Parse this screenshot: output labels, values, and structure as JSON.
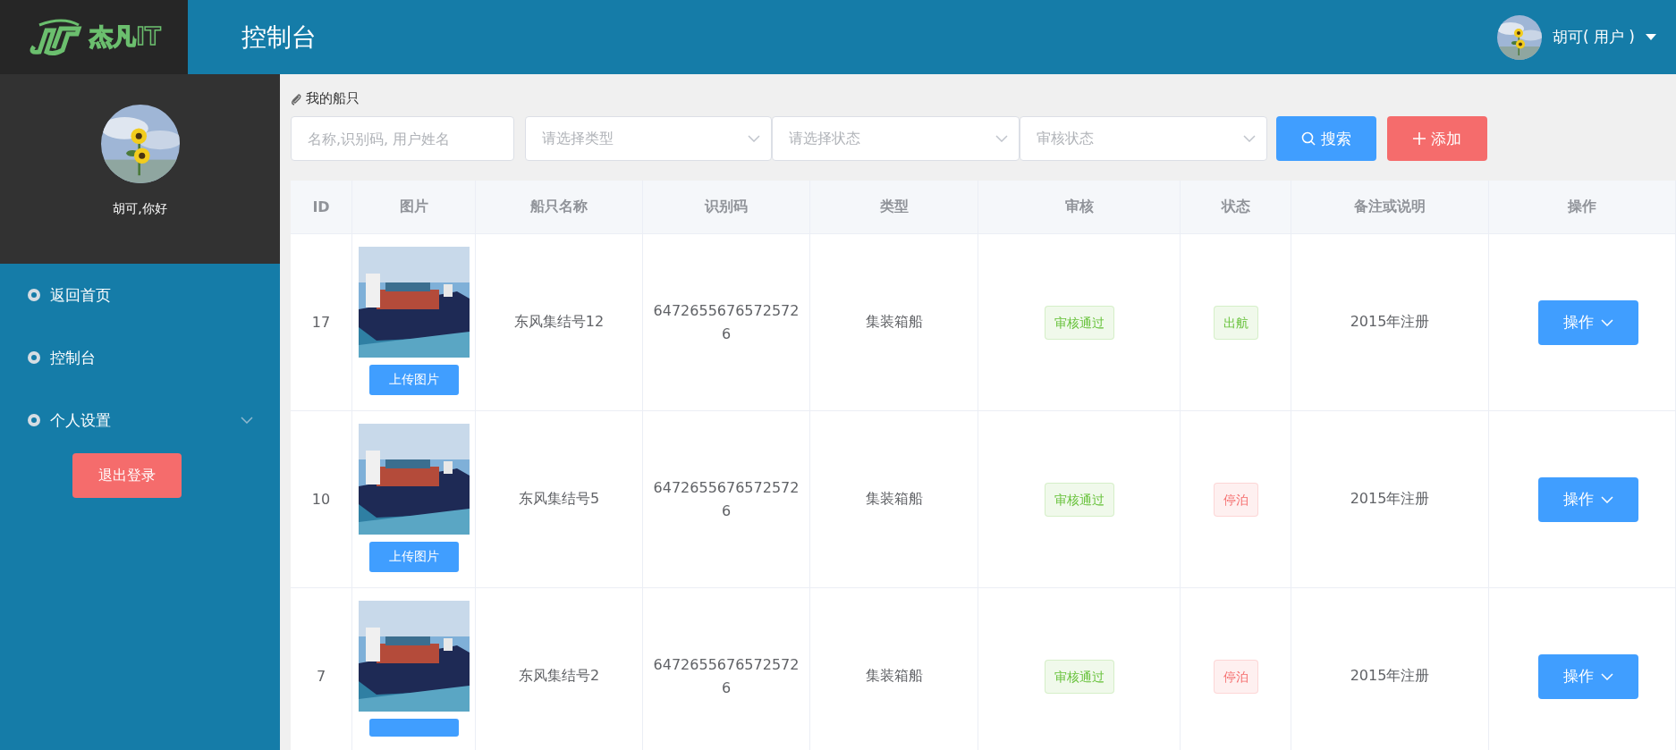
{
  "header": {
    "logo_text": "杰凡IT",
    "title": "控制台",
    "user": "胡可( 用户 )"
  },
  "sidebar": {
    "greeting": "胡可,你好",
    "items": [
      {
        "label": "返回首页",
        "has_submenu": false
      },
      {
        "label": "控制台",
        "has_submenu": false
      },
      {
        "label": "个人设置",
        "has_submenu": true
      }
    ],
    "logout": "退出登录"
  },
  "page": {
    "title": "我的船只"
  },
  "filters": {
    "search": {
      "placeholder": "名称,识别码, 用户姓名"
    },
    "selects": [
      {
        "placeholder": "请选择类型"
      },
      {
        "placeholder": "请选择状态"
      },
      {
        "placeholder": "审核状态"
      }
    ],
    "search_button": "搜索",
    "add_button": "添加"
  },
  "table": {
    "columns": [
      "ID",
      "图片",
      "船只名称",
      "识别码",
      "类型",
      "审核",
      "状态",
      "备注或说明",
      "操作"
    ],
    "rows": [
      {
        "id": "17",
        "upload": "上传图片",
        "name": "东风集结号12",
        "code": "6472655676572572 6",
        "type": "集装箱船",
        "audit": {
          "text": "审核通过",
          "color": "#67c23a"
        },
        "status": {
          "text": "出航",
          "color": "#67c23a"
        },
        "remark": "2015年注册",
        "action": "操作"
      },
      {
        "id": "10",
        "upload": "上传图片",
        "name": "东风集结号5",
        "code": "6472655676572572 6",
        "type": "集装箱船",
        "audit": {
          "text": "审核通过",
          "color": "#67c23a"
        },
        "status": {
          "text": "停泊",
          "color": "#f56c6c"
        },
        "remark": "2015年注册",
        "action": "操作"
      },
      {
        "id": "7",
        "name": "东风集结号2",
        "code": "6472655676572572 6",
        "type": "集装箱船",
        "audit": {
          "text": "审核通过",
          "color": "#67c23a"
        },
        "status": {
          "text": "停泊",
          "color": "#f56c6c"
        },
        "remark": "2015年注册",
        "action": "操作"
      }
    ]
  }
}
